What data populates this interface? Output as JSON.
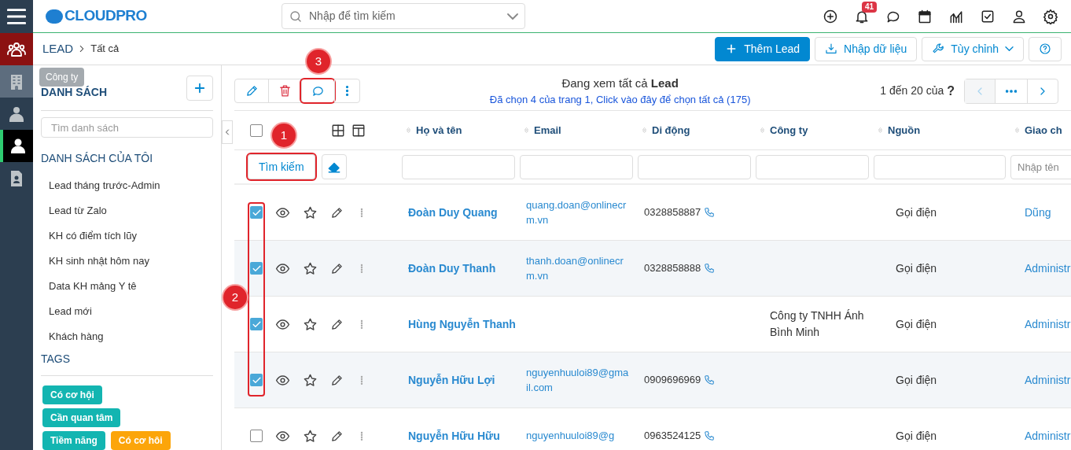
{
  "topbar": {
    "logo": "CLOUDPRO",
    "search_placeholder": "Nhập để tìm kiếm",
    "notification_count": "41"
  },
  "rail": [
    {
      "kind": "leads",
      "selected": false
    },
    {
      "kind": "building",
      "selected": false,
      "tooltip": "Công ty"
    },
    {
      "kind": "contact",
      "selected": false
    },
    {
      "kind": "person",
      "selected": true
    },
    {
      "kind": "document",
      "selected": false
    }
  ],
  "breadcrumb": {
    "module": "LEAD",
    "current": "Tất cả"
  },
  "actions": [
    {
      "kind": "add",
      "label": "Thêm Lead"
    },
    {
      "kind": "import",
      "label": "Nhập dữ liệu"
    },
    {
      "kind": "customize",
      "label": "Tùy chỉnh"
    },
    {
      "kind": "help"
    }
  ],
  "sidebar": {
    "lists_title": "DANH SÁCH",
    "search_placeholder": "Tìm danh sách",
    "my_lists_title": "DANH SÁCH CỦA TÔI",
    "items": [
      "Lead tháng trước-Admin",
      "Lead từ Zalo",
      "KH có điểm tích lũy",
      "KH sinh nhật hôm nay",
      "Data KH mảng Y tê",
      "Lead mới",
      "Khách hàng"
    ],
    "tags_title": "TAGS",
    "tags": [
      {
        "label": "Có cơ hội",
        "color": "#13b5b1"
      },
      {
        "label": "Cần quan tâm",
        "color": "#13b5b1"
      },
      {
        "label": "Tiềm năng",
        "color": "#13b5b1"
      },
      {
        "label": "Có cơ hôi",
        "color": "#fca50a"
      }
    ]
  },
  "toolbar": {
    "buttons": [
      {
        "kind": "edit"
      },
      {
        "kind": "delete"
      },
      {
        "kind": "comment",
        "callout": "3"
      },
      {
        "kind": "more"
      }
    ],
    "viewing": "Đang xem tất cả **Lead**",
    "selection_note": "Đã chọn 4 của trang 1, Click vào đây để chọn tất cả (175)",
    "range": "1 đến 20 của",
    "range_help": "?",
    "prev_disabled": true
  },
  "table": {
    "columns": [
      {
        "label": "Họ và tên"
      },
      {
        "label": "Email"
      },
      {
        "label": "Di động"
      },
      {
        "label": "Công ty"
      },
      {
        "label": "Nguồn"
      },
      {
        "label": "Giao ch",
        "filter_placeholder": "Nhập tên"
      }
    ],
    "all_selected": false,
    "search_button": {
      "label": "Tìm kiếm",
      "callout": "1"
    },
    "selection_callout": "2",
    "rows": [
      {
        "selected": true,
        "name": "Đoàn Duy Quang",
        "email": "quang.doan@onlinecrm.vn",
        "mobile": "0328858887",
        "source": "Gọi điện",
        "assigned": "Dũng"
      },
      {
        "selected": true,
        "name": "Đoàn Duy Thanh",
        "email": "thanh.doan@onlinecrm.vn",
        "mobile": "0328858888",
        "source": "Gọi điện",
        "assigned": "Administr"
      },
      {
        "selected": true,
        "name": "Hùng Nguyễn Thanh",
        "company": "Công ty TNHH Ánh Bình Minh",
        "source": "Gọi điện",
        "assigned": "Administr"
      },
      {
        "selected": true,
        "name": "Nguyễn Hữu Lợi",
        "email": "nguyenhuuloi89@gmail.com",
        "mobile": "0909696969",
        "source": "Gọi điện",
        "assigned": "Administr"
      },
      {
        "selected": false,
        "name": "Nguyễn Hữu Hữu",
        "email": "nguyenhuuloi89@g",
        "mobile": "0963524125",
        "source": "Gọi điện",
        "assigned": "Administr"
      }
    ]
  }
}
